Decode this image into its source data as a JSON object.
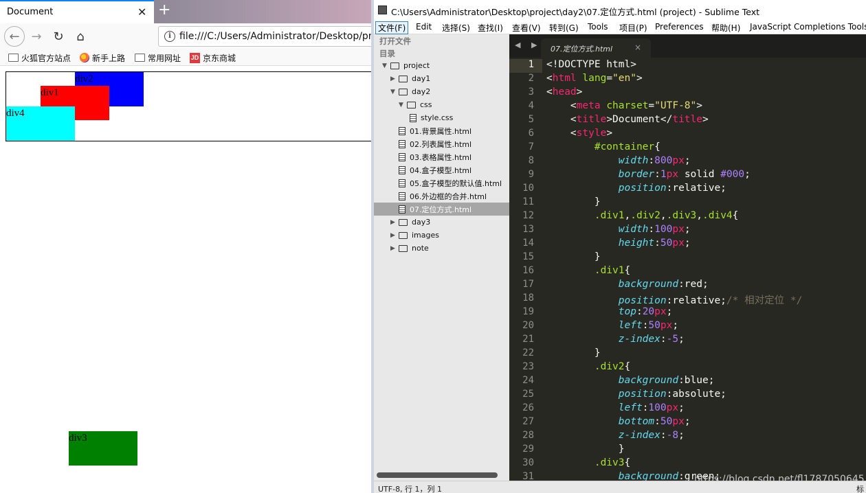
{
  "browser": {
    "tab_title": "Document",
    "tab_close": "✕",
    "new_tab": "+",
    "url": "file:///C:/Users/Administrator/Desktop/pro",
    "bookmarks": [
      "火狐官方站点",
      "新手上路",
      "常用网址",
      "京东商城"
    ],
    "jd_icon_text": "JD"
  },
  "page": {
    "div1": "div1",
    "div2": "div2",
    "div3": "div3",
    "div4": "div4",
    "colors": {
      "div1": "#ff0000",
      "div2": "#0000ff",
      "div3": "#008000",
      "div4": "#00ffff"
    }
  },
  "sublime": {
    "window_title": "C:\\Users\\Administrator\\Desktop\\project\\day2\\07.定位方式.html (project) - Sublime Text",
    "menu": [
      "文件(F)",
      "Edit",
      "选择(S)",
      "查找(I)",
      "查看(V)",
      "转到(G)",
      "Tools",
      "项目(P)",
      "Preferences",
      "帮助(H)",
      "JavaScript Completions Tools"
    ],
    "sidebar_headers": [
      "打开文件",
      "目录"
    ],
    "tree": [
      {
        "label": "project",
        "indent": 0,
        "arrow": "▼",
        "kind": "folder-open"
      },
      {
        "label": "day1",
        "indent": 1,
        "arrow": "▶",
        "kind": "folder"
      },
      {
        "label": "day2",
        "indent": 1,
        "arrow": "▼",
        "kind": "folder-open"
      },
      {
        "label": "css",
        "indent": 2,
        "arrow": "▼",
        "kind": "folder-open"
      },
      {
        "label": "style.css",
        "indent": 3,
        "arrow": "",
        "kind": "file"
      },
      {
        "label": "01.背景属性.html",
        "indent": 2,
        "arrow": "",
        "kind": "file"
      },
      {
        "label": "02.列表属性.html",
        "indent": 2,
        "arrow": "",
        "kind": "file"
      },
      {
        "label": "03.表格属性.html",
        "indent": 2,
        "arrow": "",
        "kind": "file"
      },
      {
        "label": "04.盒子模型.html",
        "indent": 2,
        "arrow": "",
        "kind": "file"
      },
      {
        "label": "05.盒子模型的默认值.html",
        "indent": 2,
        "arrow": "",
        "kind": "file"
      },
      {
        "label": "06.外边框的合并.html",
        "indent": 2,
        "arrow": "",
        "kind": "file"
      },
      {
        "label": "07.定位方式.html",
        "indent": 2,
        "arrow": "",
        "kind": "file",
        "selected": true
      },
      {
        "label": "day3",
        "indent": 1,
        "arrow": "▶",
        "kind": "folder"
      },
      {
        "label": "images",
        "indent": 1,
        "arrow": "▶",
        "kind": "folder"
      },
      {
        "label": "note",
        "indent": 1,
        "arrow": "▶",
        "kind": "folder"
      }
    ],
    "tab_nav": "◀ ▶",
    "editor_tab": "07.定位方式.html",
    "editor_tab_close": "×",
    "code_lines": [
      {
        "n": "1",
        "html": "&lt;!DOCTYPE html&gt;"
      },
      {
        "n": "2",
        "html": "&lt;<span class='tk-t'>html</span> <span class='tk-a'>lang</span>=<span class='tk-s'>\"en\"</span>&gt;"
      },
      {
        "n": "3",
        "html": "&lt;<span class='tk-t'>head</span>&gt;"
      },
      {
        "n": "4",
        "html": "    &lt;<span class='tk-t'>meta</span> <span class='tk-a'>charset</span>=<span class='tk-s'>\"UTF-8\"</span>&gt;"
      },
      {
        "n": "5",
        "html": "    &lt;<span class='tk-t'>title</span>&gt;Document&lt;/<span class='tk-t'>title</span>&gt;"
      },
      {
        "n": "6",
        "html": "    &lt;<span class='tk-t'>style</span>&gt;"
      },
      {
        "n": "7",
        "html": "        <span class='tk-sel'>#container</span>{"
      },
      {
        "n": "8",
        "html": "            <span class='tk-p'>width</span>:<span class='tk-n'>800</span><span class='tk-u'>px</span>;"
      },
      {
        "n": "9",
        "html": "            <span class='tk-p'>border</span>:<span class='tk-n'>1</span><span class='tk-u'>px</span> solid <span class='tk-n'>#000</span>;"
      },
      {
        "n": "10",
        "html": "            <span class='tk-p'>position</span>:relative;"
      },
      {
        "n": "11",
        "html": "        }"
      },
      {
        "n": "12",
        "html": "        <span class='tk-sel'>.div1</span>,<span class='tk-sel'>.div2</span>,<span class='tk-sel'>.div3</span>,<span class='tk-sel'>.div4</span>{"
      },
      {
        "n": "13",
        "html": "            <span class='tk-p'>width</span>:<span class='tk-n'>100</span><span class='tk-u'>px</span>;"
      },
      {
        "n": "14",
        "html": "            <span class='tk-p'>height</span>:<span class='tk-n'>50</span><span class='tk-u'>px</span>;"
      },
      {
        "n": "15",
        "html": "        }"
      },
      {
        "n": "16",
        "html": "        <span class='tk-sel'>.div1</span>{"
      },
      {
        "n": "17",
        "html": "            <span class='tk-p'>background</span>:red;"
      },
      {
        "n": "18",
        "html": "            <span class='tk-p'>position</span>:relative;<span class='tk-c'>/* 相对定位 */</span>"
      },
      {
        "n": "19",
        "html": "            <span class='tk-p'>top</span>:<span class='tk-n'>20</span><span class='tk-u'>px</span>;"
      },
      {
        "n": "20",
        "html": "            <span class='tk-p'>left</span>:<span class='tk-n'>50</span><span class='tk-u'>px</span>;"
      },
      {
        "n": "21",
        "html": "            <span class='tk-p'>z-index</span>:<span class='tk-n'>-5</span>;"
      },
      {
        "n": "22",
        "html": "        }"
      },
      {
        "n": "23",
        "html": "        <span class='tk-sel'>.div2</span>{"
      },
      {
        "n": "24",
        "html": "            <span class='tk-p'>background</span>:blue;"
      },
      {
        "n": "25",
        "html": "            <span class='tk-p'>position</span>:absolute;"
      },
      {
        "n": "26",
        "html": "            <span class='tk-p'>left</span>:<span class='tk-n'>100</span><span class='tk-u'>px</span>;"
      },
      {
        "n": "27",
        "html": "            <span class='tk-p'>bottom</span>:<span class='tk-n'>50</span><span class='tk-u'>px</span>;"
      },
      {
        "n": "28",
        "html": "            <span class='tk-p'>z-index</span>:<span class='tk-n'>-8</span>;"
      },
      {
        "n": "29",
        "html": "            }"
      },
      {
        "n": "30",
        "html": "        <span class='tk-sel'>.div3</span>{"
      },
      {
        "n": "31",
        "html": "            <span class='tk-p'>background</span>:green;"
      }
    ],
    "status": "UTF-8, 行 1，列 1",
    "status_right": "标",
    "watermark": "https://blog.csdn.net/fl1787050645"
  }
}
